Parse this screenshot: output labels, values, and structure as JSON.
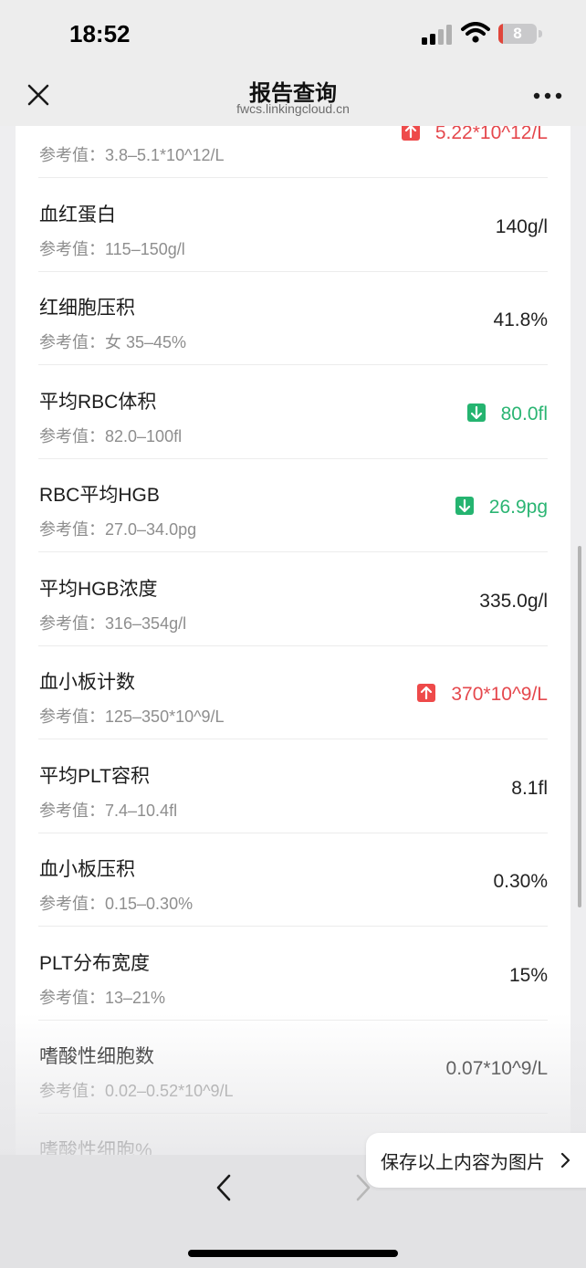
{
  "status_bar": {
    "time": "18:52",
    "battery": "8"
  },
  "nav": {
    "title": "报告查询",
    "url": "fwcs.linkingcloud.cn"
  },
  "results": [
    {
      "name": "",
      "ref": "参考值：3.8–5.1*10^12/L",
      "value": "5.22*10^12/L",
      "flag": "high"
    },
    {
      "name": "血红蛋白",
      "ref": "参考值：115–150g/l",
      "value": "140g/l",
      "flag": "normal"
    },
    {
      "name": "红细胞压积",
      "ref": "参考值：女 35–45%",
      "value": "41.8%",
      "flag": "normal"
    },
    {
      "name": "平均RBC体积",
      "ref": "参考值：82.0–100fl",
      "value": "80.0fl",
      "flag": "low"
    },
    {
      "name": "RBC平均HGB",
      "ref": "参考值：27.0–34.0pg",
      "value": "26.9pg",
      "flag": "low"
    },
    {
      "name": "平均HGB浓度",
      "ref": "参考值：316–354g/l",
      "value": "335.0g/l",
      "flag": "normal"
    },
    {
      "name": "血小板计数",
      "ref": "参考值：125–350*10^9/L",
      "value": "370*10^9/L",
      "flag": "high"
    },
    {
      "name": "平均PLT容积",
      "ref": "参考值：7.4–10.4fl",
      "value": "8.1fl",
      "flag": "normal"
    },
    {
      "name": "血小板压积",
      "ref": "参考值：0.15–0.30%",
      "value": "0.30%",
      "flag": "normal"
    },
    {
      "name": "PLT分布宽度",
      "ref": "参考值：13–21%",
      "value": "15%",
      "flag": "normal"
    },
    {
      "name": "嗜酸性细胞数",
      "ref": "参考值：0.02–0.52*10^9/L",
      "value": "0.07*10^9/L",
      "flag": "normal"
    },
    {
      "name": "嗜酸性细胞%",
      "ref": "",
      "value": "",
      "flag": "normal"
    }
  ],
  "save_button": {
    "label": "保存以上内容为图片"
  },
  "colors": {
    "high": "#e5484d",
    "low": "#2bb573"
  },
  "icons": [
    "close-icon",
    "more-icon",
    "arrow-up-icon",
    "arrow-down-icon",
    "chevron-right-icon",
    "chevron-left-icon"
  ]
}
